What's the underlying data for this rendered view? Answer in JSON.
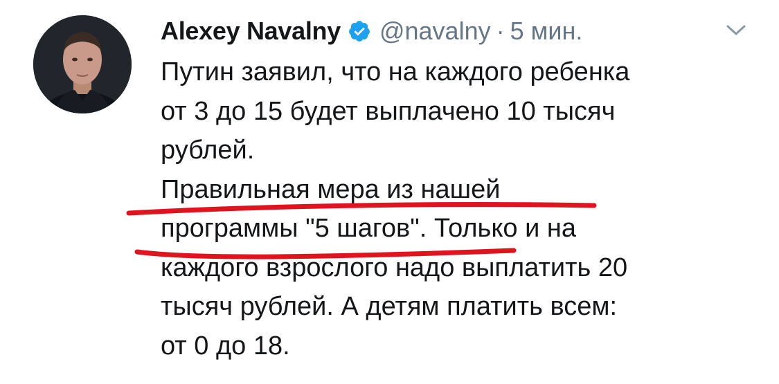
{
  "tweet": {
    "display_name": "Alexey Navalny",
    "handle": "@navalny",
    "separator": "·",
    "time": "5 мин.",
    "verified_icon": "verified-badge-icon",
    "menu_icon": "chevron-down-icon",
    "avatar_icon": "avatar-photo",
    "lines": [
      "Путин заявил, что на каждого ребенка",
      "от 3 до 15 будет выплачено 10 тысяч",
      "рублей.",
      "Правильная мера из нашей",
      "программы \"5 шагов\". Только и на",
      "каждого взрослого надо выплатить 20",
      "тысяч рублей. А детям платить всем:",
      "от 0 до 18."
    ]
  },
  "colors": {
    "text": "#14171a",
    "secondary": "#657786",
    "verified": "#1da1f2",
    "annotation": "#e0141e"
  }
}
